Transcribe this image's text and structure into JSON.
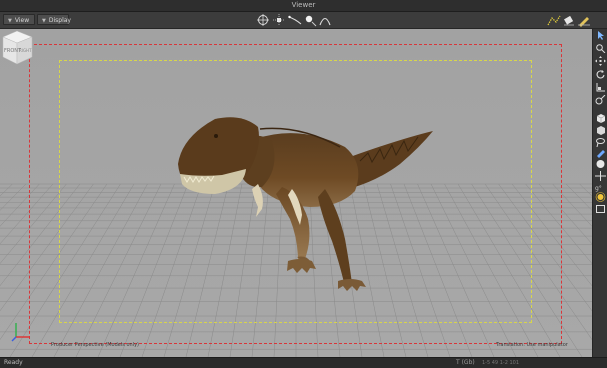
{
  "window": {
    "title": "Viewer"
  },
  "toolbar": {
    "view_label": "View",
    "display_label": "Display",
    "tools": [
      "rotate-gizmo-icon",
      "move-gizmo-icon",
      "curve-tool-icon",
      "point-tool-icon",
      "arc-tool-icon"
    ],
    "right_tools": [
      "path-icon",
      "eraser-icon",
      "pen-icon"
    ]
  },
  "viewport": {
    "camera_caption": "Producer Perspective (Models only)",
    "manipulator_caption": "Translation: Use manipulator",
    "viewcube_front": "FRONT",
    "viewcube_right": "RIGHT",
    "frame_colors": {
      "safe_action": "#d9363a",
      "safe_title": "#d7d64a"
    },
    "background": "#a4a4a4"
  },
  "right_toolbar": {
    "icons": [
      "select-arrow-icon",
      "zoom-icon",
      "move-icon",
      "rotate-icon",
      "scale-icon",
      "transform-icon",
      "cube-icon",
      "box-icon",
      "lasso-icon",
      "paint-icon",
      "sphere-icon",
      "pivot-icon",
      "snap-icon",
      "light-icon",
      "frame-icon"
    ]
  },
  "status": {
    "message": "Ready",
    "right_text": "T (Gb)",
    "right_text2": "1-5 49   1-2 101"
  }
}
